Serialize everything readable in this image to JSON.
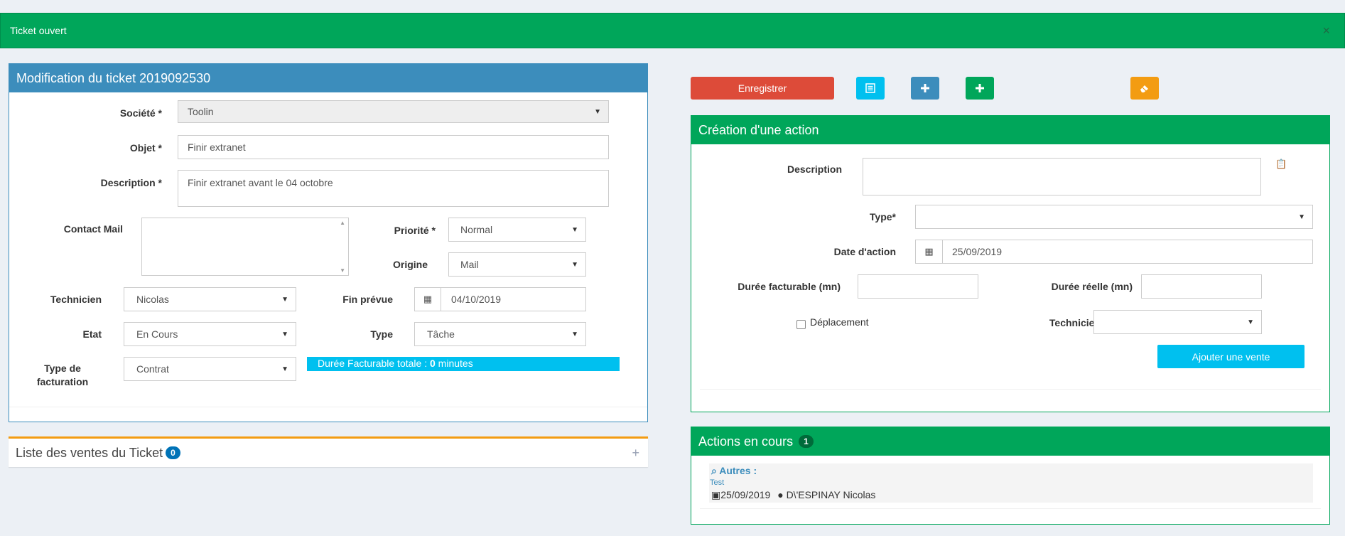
{
  "alert": {
    "text": "Ticket ouvert",
    "close": "×"
  },
  "ticket": {
    "title": "Modification du ticket 2019092530",
    "societe": {
      "label": "Société",
      "req": "*",
      "value": "Toolin"
    },
    "objet": {
      "label": "Objet",
      "req": "*",
      "value": "Finir extranet"
    },
    "description": {
      "label": "Description",
      "req": "*",
      "value": "Finir extranet avant le 04 octobre"
    },
    "contact_mail": {
      "label": "Contact Mail",
      "value": ""
    },
    "priorite": {
      "label": "Priorité",
      "req": "*",
      "value": "Normal"
    },
    "origine": {
      "label": "Origine",
      "value": "Mail"
    },
    "technicien": {
      "label": "Technicien",
      "value": "Nicolas"
    },
    "fin_prevue": {
      "label": "Fin prévue",
      "value": "04/10/2019"
    },
    "etat": {
      "label": "Etat",
      "value": "En Cours"
    },
    "type": {
      "label": "Type",
      "value": "Tâche"
    },
    "type_facturation": {
      "label_line1": "Type de",
      "label_line2": "facturation",
      "value": "Contrat"
    },
    "duree_totale": {
      "prefix": "Durée Facturable totale : ",
      "value": "0",
      "suffix": " minutes"
    }
  },
  "sales": {
    "title": "Liste des ventes du Ticket",
    "count": "0",
    "expand": "+"
  },
  "toolbar": {
    "save_label": "Enregistrer",
    "colors": {
      "save": "#dd4b39",
      "list": "#00c0ef",
      "add_blue": "#3c8dbc",
      "add_green": "#00a65a",
      "erase": "#f39c12"
    }
  },
  "action": {
    "title": "Création d'une action",
    "description": {
      "label": "Description",
      "value": ""
    },
    "type": {
      "label": "Type*",
      "value": ""
    },
    "date": {
      "label": "Date d'action",
      "value": "25/09/2019"
    },
    "duree_facturable": {
      "label": "Durée facturable (mn)",
      "value": ""
    },
    "duree_reelle": {
      "label": "Durée réelle (mn)",
      "value": ""
    },
    "deplacement": {
      "label": "Déplacement",
      "checked": false
    },
    "technicien": {
      "label": "Technicien",
      "value": ""
    },
    "add_sale_label": "Ajouter une vente"
  },
  "current": {
    "title": "Actions en cours",
    "count": "1",
    "item": {
      "category": "Autres :",
      "name": "Test",
      "date": "25/09/2019",
      "user": "D\\'ESPINAY Nicolas"
    }
  }
}
